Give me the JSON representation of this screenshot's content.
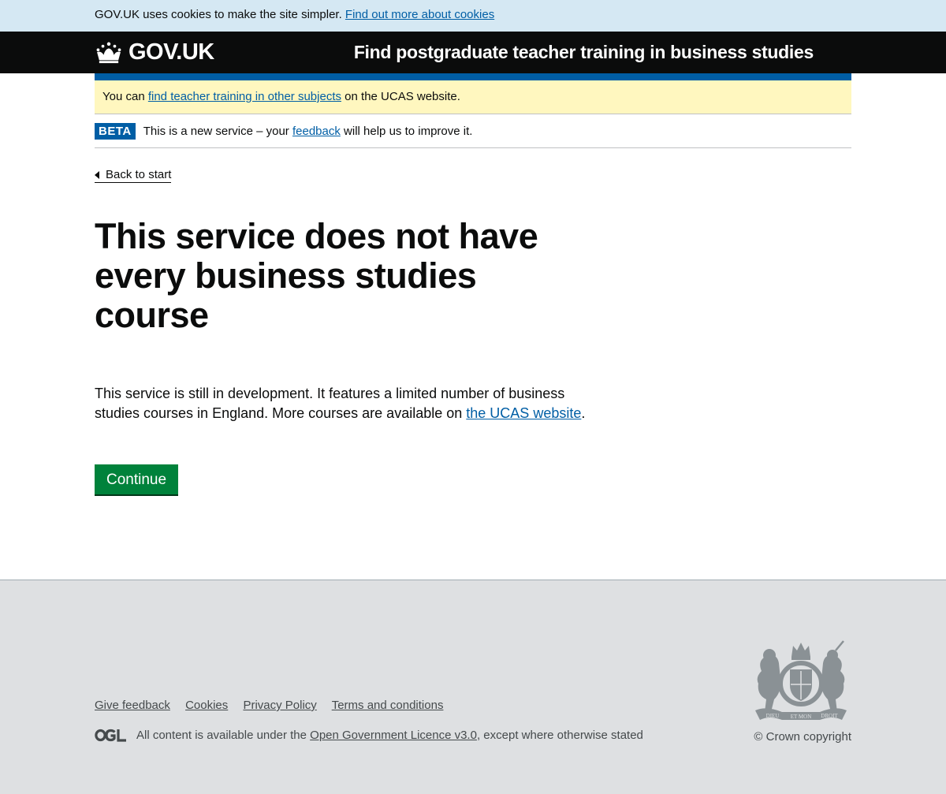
{
  "cookie_banner": {
    "text": "GOV.UK uses cookies to make the site simpler.",
    "link": "Find out more about cookies"
  },
  "header": {
    "logo_text": "GOV.UK",
    "service_name": "Find postgraduate teacher training in business studies"
  },
  "notice": {
    "prefix": "You can",
    "link": "find teacher training in other subjects",
    "suffix": "on the UCAS website."
  },
  "phase_banner": {
    "tag": "BETA",
    "prefix": "This is a new service – your",
    "link": "feedback",
    "suffix": "will help us to improve it."
  },
  "back_link": "Back to start",
  "main": {
    "heading": "This service does not have every business studies course",
    "body_prefix": "This service is still in development. It features a limited number of business studies courses in England. More courses are available on",
    "body_link": "the UCAS website",
    "body_suffix": ".",
    "button": "Continue"
  },
  "footer": {
    "links": [
      "Give feedback",
      "Cookies",
      "Privacy Policy",
      "Terms and conditions"
    ],
    "licence_prefix": "All content is available under the",
    "licence_link": "Open Government Licence v3.0",
    "licence_suffix": ", except where otherwise stated",
    "copyright": "© Crown copyright",
    "crest_motto_1": "DIEU",
    "crest_motto_2": "ET MON",
    "crest_motto_3": "DROIT"
  },
  "colors": {
    "brand_blue": "#005ea5",
    "button_green": "#00823b",
    "header_black": "#0b0c0c",
    "notice_yellow": "#fff7bf",
    "cookie_blue": "#d5e8f3",
    "footer_grey": "#dee0e2"
  },
  "icons": {
    "logo": "crown-icon",
    "back": "triangle-left-icon",
    "licence": "ogl-logo-icon",
    "crest": "royal-coat-of-arms-icon"
  }
}
